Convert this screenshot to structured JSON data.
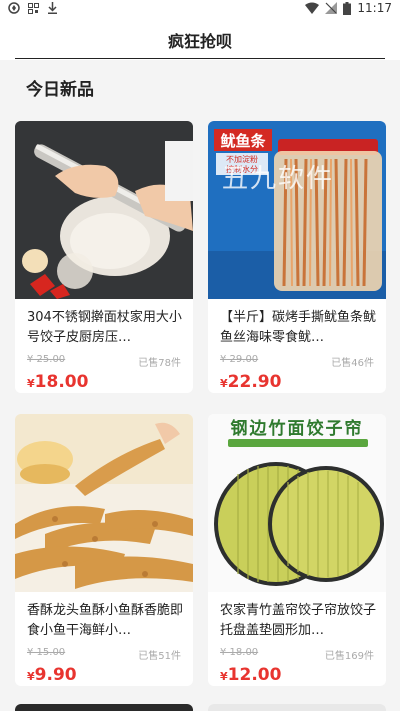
{
  "status_bar": {
    "time": "11:17",
    "left_icons": [
      "app-icon",
      "qr-icon",
      "download-icon"
    ],
    "right_icons": [
      "wifi-icon",
      "signal-icon",
      "battery-icon"
    ]
  },
  "header": {
    "title": "疯狂抢呗"
  },
  "section": {
    "title": "今日新品"
  },
  "watermark": "丑九软件",
  "products": [
    {
      "name": "304不锈钢擀面杖家用大小号饺子皮厨房压…",
      "original_price": "¥ 25.00",
      "sold": "已售78件",
      "currency": "¥",
      "price": "18.00"
    },
    {
      "name": "【半斤】碳烤手撕鱿鱼条鱿鱼丝海味零食鱿…",
      "original_price": "¥ 29.00",
      "sold": "已售46件",
      "currency": "¥",
      "price": "22.90"
    },
    {
      "name": "香酥龙头鱼酥小鱼酥香脆即食小鱼干海鲜小…",
      "original_price": "¥ 15.00",
      "sold": "已售51件",
      "currency": "¥",
      "price": "9.90"
    },
    {
      "name": "农家青竹盖帘饺子帘放饺子托盘盖垫圆形加…",
      "original_price": "¥ 18.00",
      "sold": "已售169件",
      "currency": "¥",
      "price": "12.00"
    }
  ],
  "image_labels": {
    "squid_banner": "鱿鱼条",
    "squid_sub1": "不加淀粉",
    "squid_sub2": "控制水分",
    "bamboo_banner": "钢边竹面饺子帘"
  },
  "colors": {
    "price": "#e8342f",
    "background": "#f4f4f4"
  }
}
